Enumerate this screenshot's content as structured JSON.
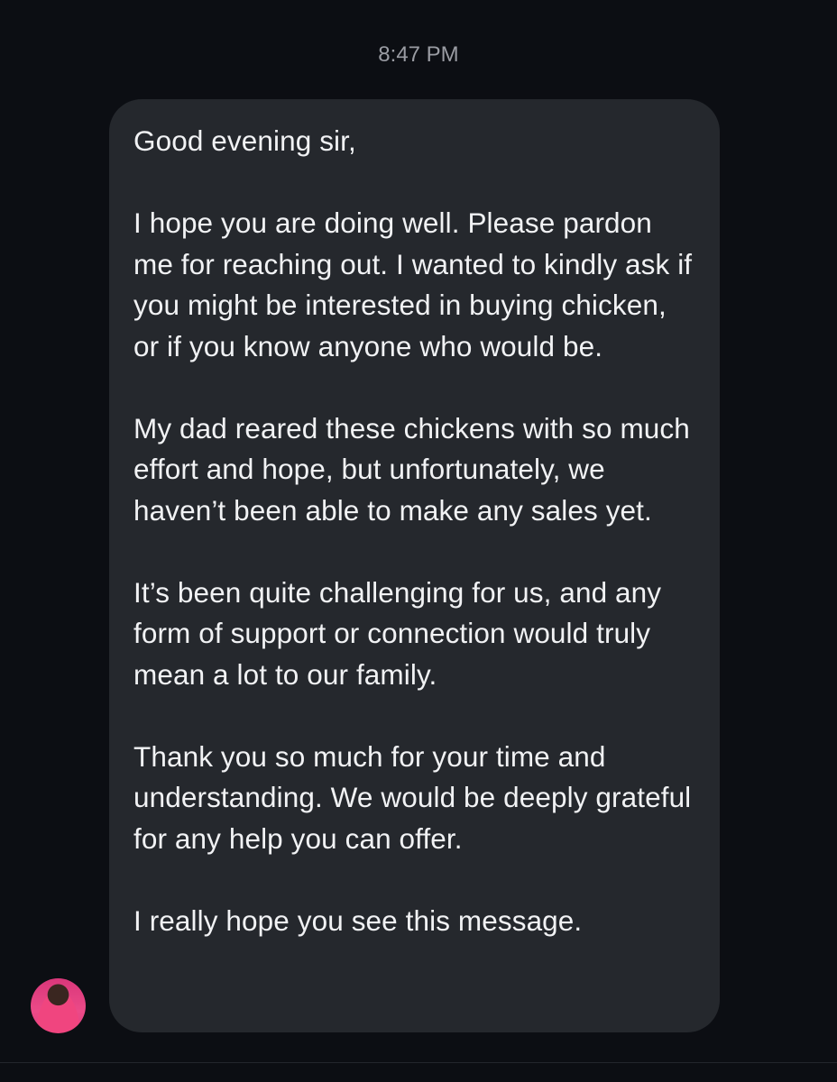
{
  "chat": {
    "timestamp": "8:47 PM",
    "message": {
      "paragraphs": [
        "Good evening sir,",
        "I hope you are doing well. Please pardon me for reaching out. I wanted to kindly ask if you might be interested in buying chicken, or if you know anyone who would be.",
        "My dad reared these chickens with so much effort and hope, but unfortunately, we haven’t been able to make any sales yet.",
        "It’s been quite challenging for us, and any form of support or connection would truly mean a lot to our family.",
        "Thank you so much for your time and understanding. We would be deeply grateful for any help you can offer.",
        "I really hope you see this message."
      ]
    },
    "sender": {
      "avatar_icon": "profile-avatar-icon",
      "avatar_color": "#e8437f"
    }
  }
}
